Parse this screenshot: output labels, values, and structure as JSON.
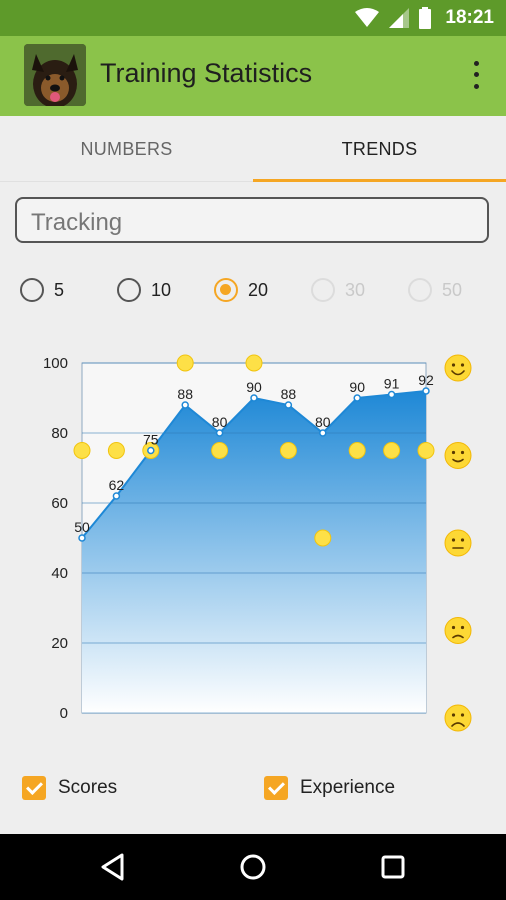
{
  "status_bar": {
    "time": "18:21",
    "icons": [
      "wifi-icon",
      "signal-icon",
      "battery-icon"
    ]
  },
  "app_bar": {
    "title": "Training Statistics",
    "avatar_icon": "dog-avatar",
    "menu_icon": "overflow-menu-icon"
  },
  "tabs": [
    {
      "label": "NUMBERS",
      "selected": false
    },
    {
      "label": "TRENDS",
      "selected": true
    }
  ],
  "spinner": {
    "value": "Tracking"
  },
  "range_options": [
    {
      "label": "5",
      "checked": false,
      "enabled": true
    },
    {
      "label": "10",
      "checked": false,
      "enabled": true
    },
    {
      "label": "20",
      "checked": true,
      "enabled": true
    },
    {
      "label": "30",
      "checked": false,
      "enabled": false
    },
    {
      "label": "50",
      "checked": false,
      "enabled": false
    }
  ],
  "chart_data": {
    "type": "area",
    "ylim": [
      0,
      100
    ],
    "y_ticks": [
      "0",
      "20",
      "40",
      "60",
      "80",
      "100"
    ],
    "series": [
      {
        "name": "Scores",
        "values": [
          50,
          62,
          75,
          88,
          80,
          90,
          88,
          80,
          90,
          91,
          92
        ],
        "labels": [
          "50",
          "62",
          "75",
          "88",
          "80",
          "90",
          "88",
          "80",
          "90",
          "91",
          "92"
        ],
        "color": "#1e88d6"
      },
      {
        "name": "Experience",
        "values": [
          75,
          75,
          75,
          100,
          75,
          100,
          75,
          50,
          75,
          75,
          75
        ],
        "color": "#fde047"
      }
    ],
    "mood_scale_icons": [
      "very-happy-face-icon",
      "happy-face-icon",
      "neutral-face-icon",
      "sad-face-icon",
      "very-sad-face-icon"
    ],
    "grid": true
  },
  "legend_toggles": [
    {
      "label": "Scores",
      "checked": true
    },
    {
      "label": "Experience",
      "checked": true
    }
  ],
  "nav_bar": {
    "icons": [
      "back-icon",
      "home-icon",
      "recents-icon"
    ]
  },
  "colors": {
    "status_bar": "#5e9a2a",
    "app_bar": "#8bc34a",
    "accent": "#f5a623",
    "area_fill": "#1e88d6",
    "experience_dot": "#fde047"
  }
}
